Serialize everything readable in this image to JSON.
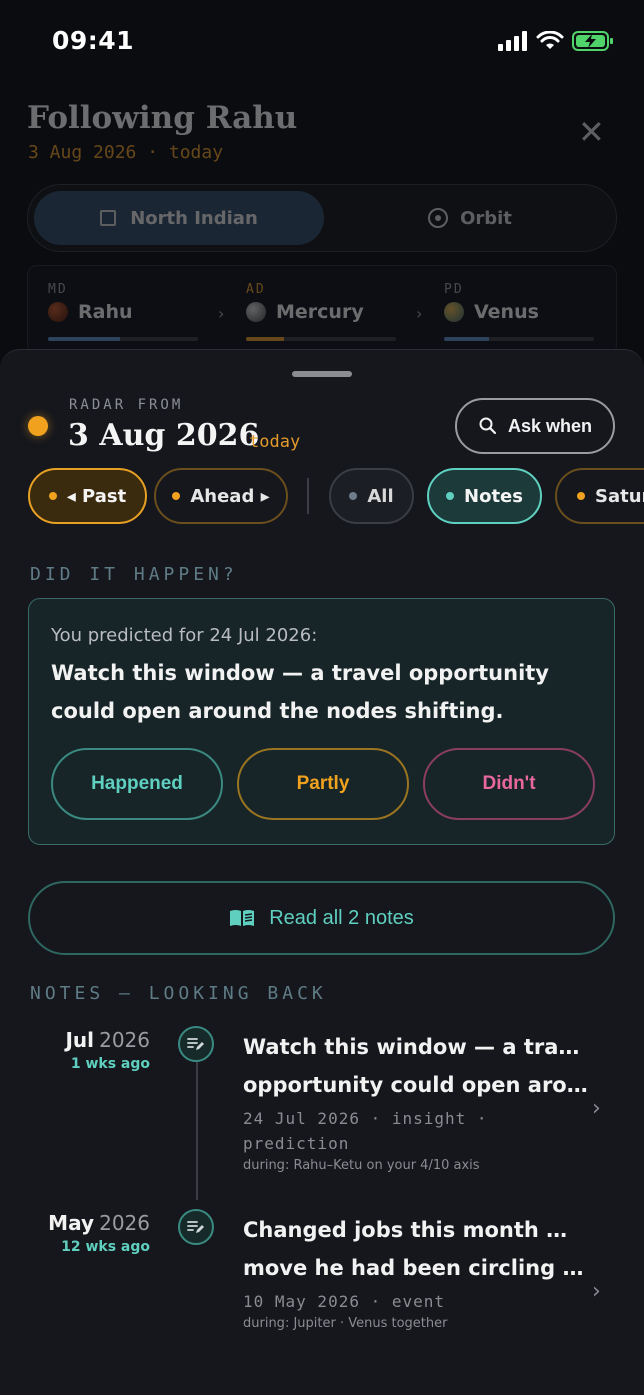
{
  "status": {
    "time": "09:41"
  },
  "background": {
    "title": "Following Rahu",
    "subtitle": "3 Aug 2026 · today",
    "close_label": "✕",
    "view_options": [
      {
        "label": "North Indian",
        "selected": true
      },
      {
        "label": "Orbit",
        "selected": false
      }
    ],
    "dasha": [
      {
        "level": "MD",
        "planet": "Rahu",
        "progress": 0.48
      },
      {
        "level": "AD",
        "planet": "Mercury",
        "progress": 0.25
      },
      {
        "level": "PD",
        "planet": "Venus",
        "progress": 0.3
      }
    ]
  },
  "sheet": {
    "radar_label": "RADAR FROM",
    "date": "3 Aug 2026",
    "today": "today",
    "ask_label": "Ask when",
    "chips": {
      "past": "◂ Past",
      "ahead": "Ahead ▸",
      "all": "All",
      "notes": "Notes",
      "saturn": "Saturn"
    },
    "did_it_happen": "DID IT HAPPEN?",
    "prediction": {
      "question": "You predicted for 24 Jul 2026:",
      "text": "Watch this window — a travel opportunity could open around the nodes shifting.",
      "buttons": {
        "happened": "Happened",
        "partly": "Partly",
        "didnt": "Didn't"
      }
    },
    "read_all": "Read all 2 notes",
    "notes_header": "NOTES — LOOKING BACK",
    "notes": [
      {
        "month": "Jul",
        "year": "2026",
        "ago": "1 wks ago",
        "title_line1": "Watch this window — a travel",
        "title_line2": "opportunity could open arou…",
        "meta_line1": "24 Jul 2026 · insight ·",
        "meta_line2": "prediction",
        "during": "during: Rahu–Ketu on your 4/10 axis"
      },
      {
        "month": "May",
        "year": "2026",
        "ago": "12 wks ago",
        "title_line1": "Changed jobs this month — the",
        "title_line2": "move he had been circling fo…",
        "meta_line1": "10 May 2026 · event",
        "during": "during: Jupiter · Venus together"
      }
    ]
  },
  "colors": {
    "accent_amber": "#f0a21e",
    "accent_teal": "#5fd0c0",
    "accent_pink": "#e9679f"
  }
}
